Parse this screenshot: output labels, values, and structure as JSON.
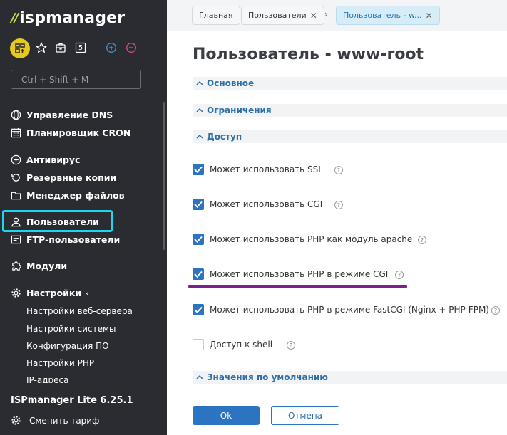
{
  "sidebar": {
    "logo": {
      "mark": "//",
      "text": "ispmanager"
    },
    "toolbar": {
      "icons": [
        "dashboard-icon",
        "star-icon",
        "briefcase-icon",
        "counter-icon",
        "plus-icon",
        "minus-icon"
      ],
      "counter": "5"
    },
    "search": {
      "placeholder": "Ctrl + Shift + M",
      "value": ""
    },
    "items": [
      {
        "label": "Управление DNS",
        "icon": "globe-icon"
      },
      {
        "label": "Планировщик CRON",
        "icon": "calendar-icon"
      },
      {
        "label": "Антивирус",
        "icon": "shield-icon"
      },
      {
        "label": "Резервные копии",
        "icon": "backup-icon"
      },
      {
        "label": "Менеджер файлов",
        "icon": "folder-icon"
      },
      {
        "label": "Пользователи",
        "icon": "user-icon",
        "active": true
      },
      {
        "label": "FTP-пользователи",
        "icon": "ftp-icon"
      },
      {
        "label": "Модули",
        "icon": "puzzle-icon"
      },
      {
        "label": "Настройки",
        "icon": "gear-icon",
        "arrow": "‹"
      }
    ],
    "subitems": [
      "Настройки веб-сервера",
      "Настройки системы",
      "Конфигурация ПО",
      "Настройки PHP",
      "IP-адреса"
    ],
    "version": "ISPmanager Lite 6.25.1",
    "tariff": "Сменить тариф",
    "highlight_color": "#1fd4ee"
  },
  "breadcrumbs": [
    {
      "label": "Главная"
    },
    {
      "label": "Пользователи",
      "close": "✕"
    },
    {
      "separator": "›"
    },
    {
      "label": "Пользователь - w...",
      "close": "✕",
      "active": true
    }
  ],
  "page": {
    "title": "Пользователь - www-root",
    "sections": [
      {
        "label": "Основное",
        "expanded": false
      },
      {
        "label": "Ограничения",
        "expanded": false
      },
      {
        "label": "Доступ",
        "expanded": true
      },
      {
        "label": "Значения по умолчанию",
        "expanded": false
      }
    ],
    "options": [
      {
        "label": "Может использовать SSL",
        "checked": true
      },
      {
        "label": "Может использовать CGI",
        "checked": true
      },
      {
        "label": "Может использовать PHP как модуль apache",
        "checked": true
      },
      {
        "label": "Может использовать PHP в режиме CGI",
        "checked": true
      },
      {
        "label": "Может использовать PHP в режиме FastCGI (Nginx + PHP-FPM)",
        "checked": true
      },
      {
        "label": "Доступ к shell",
        "checked": false
      }
    ],
    "help_glyph": "?",
    "accent_color": "#2b74c1",
    "annotation_color": "#7d1f8c"
  },
  "buttons": {
    "ok": "Ok",
    "cancel": "Отмена"
  }
}
